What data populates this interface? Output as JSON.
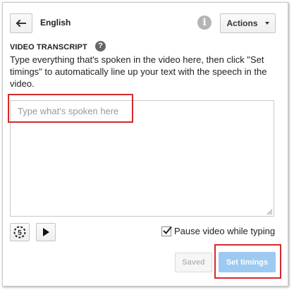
{
  "header": {
    "back_icon": "arrow-left-icon",
    "language": "English",
    "info_icon": "info-icon",
    "info_glyph": "i",
    "actions_label": "Actions",
    "actions_icon": "caret-down-icon"
  },
  "transcript": {
    "section_title": "VIDEO TRANSCRIPT",
    "help_icon": "question-mark-icon",
    "help_glyph": "?",
    "instructions": "Type everything that's spoken in the video here, then click \"Set timings\" to automatically line up your text with the speech in the video.",
    "placeholder": "Type what's spoken here",
    "value": ""
  },
  "controls": {
    "rewind_icon": "rewind-5-seconds-icon",
    "rewind_number": "5",
    "play_icon": "play-icon",
    "pause_label": "Pause video while typing",
    "pause_checked": true
  },
  "footer": {
    "saved_label": "Saved",
    "set_timings_label": "Set timings"
  },
  "colors": {
    "highlight": "#d22b2b",
    "primary_button": "#9ccaf0",
    "info_icon": "#b4b4b4",
    "help_icon": "#666666"
  }
}
